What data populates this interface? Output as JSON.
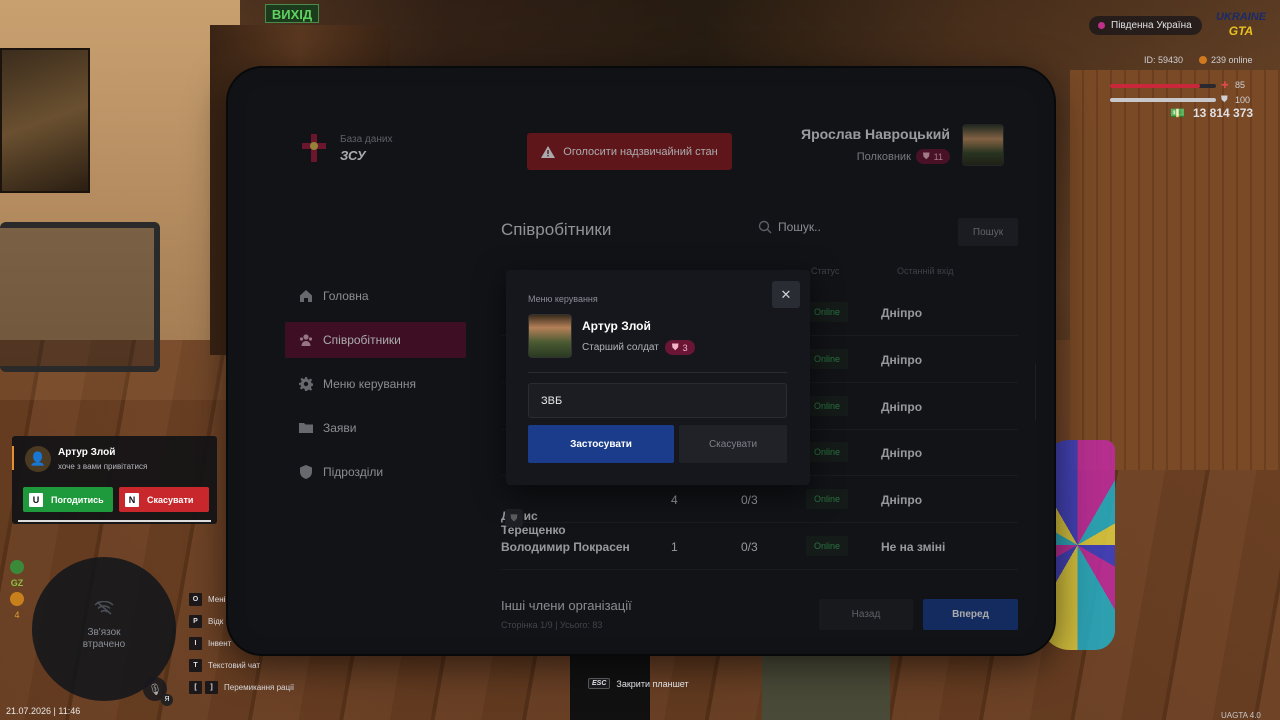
{
  "scene": {
    "exit_sign": "ВИХІД"
  },
  "tablet": {
    "brand": {
      "subtitle": "База даних",
      "title": "ЗСУ"
    },
    "emergency_button": "Оголосити надзвичайний стан",
    "profile": {
      "name": "Ярослав Навроцький",
      "rank": "Полковник",
      "rank_level": "11"
    },
    "sidebar": {
      "items": [
        {
          "label": "Головна",
          "icon": "home-icon",
          "active": false
        },
        {
          "label": "Співробітники",
          "icon": "users-icon",
          "active": true
        },
        {
          "label": "Меню керування",
          "icon": "gear-icon",
          "active": false
        },
        {
          "label": "Заяви",
          "icon": "folder-icon",
          "active": false
        },
        {
          "label": "Підрозділи",
          "icon": "shield-icon",
          "active": false
        }
      ]
    },
    "main": {
      "title": "Співробітники",
      "search": {
        "placeholder": "Пошук..",
        "button": "Пошук"
      },
      "columns": {
        "status": "Статус",
        "last_login": "Останній вхід"
      },
      "rows": [
        {
          "name": "Денис Терещенко",
          "level": "4",
          "warnings": "0/3",
          "status": "Online",
          "last_login": "Дніпро"
        },
        {
          "name": "Володимир Покрасен",
          "level": "1",
          "warnings": "0/3",
          "status": "Online",
          "last_login": "Не на зміні"
        }
      ],
      "hidden_rows_status": [
        "Online",
        "Online",
        "Online",
        "Online"
      ],
      "hidden_rows_last": [
        "Дніпро",
        "Дніпро",
        "Дніпро",
        "Дніпро"
      ],
      "others_title": "Інші члени організації",
      "others_page": "Сторінка 1/9 | Усього: 83",
      "back_button": "Назад",
      "next_button": "Вперед"
    },
    "modal": {
      "title": "Меню керування",
      "name": "Артур Злой",
      "rank": "Старший солдат",
      "rank_level": "3",
      "input_value": "ЗВБ",
      "apply_button": "Застосувати",
      "cancel_button": "Скасувати"
    }
  },
  "hud": {
    "region": "Південна Україна",
    "logo": {
      "top": "UKRAINE",
      "bottom": "GTA"
    },
    "id": "ID: 59430",
    "online": "239 online",
    "health": {
      "value": "85",
      "fraction": 0.85
    },
    "armor": {
      "value": "100",
      "fraction": 1.0
    },
    "money": "13 814 373",
    "invite": {
      "name": "Артур Злой",
      "text": "хоче з вами привітатися",
      "accept_key": "U",
      "accept": "Погодитись",
      "decline_key": "N",
      "decline": "Скасувати"
    },
    "status": {
      "label": "GZ",
      "count": "4"
    },
    "minimap_text_1": "Зв'язок",
    "minimap_text_2": "втрачено",
    "mic_key": "Я",
    "hotkeys": [
      {
        "key": "O",
        "label": "Мені"
      },
      {
        "key": "P",
        "label": "Відк"
      },
      {
        "key": "I",
        "label": "Інвент"
      },
      {
        "key": "T",
        "label": "Текстовий чат"
      },
      {
        "key": "[",
        "key2": "]",
        "label": "Перемикання рації"
      }
    ],
    "datetime": "21.07.2026 | 11:46",
    "esc_key": "ESC",
    "esc_label": "Закрити планшет",
    "version": "UAGTA 4.0"
  },
  "colors": {
    "accent_active": "#5a1030",
    "primary_button": "#1a3c8a",
    "emergency": "#8c1c22",
    "online": "#3aa85a"
  }
}
